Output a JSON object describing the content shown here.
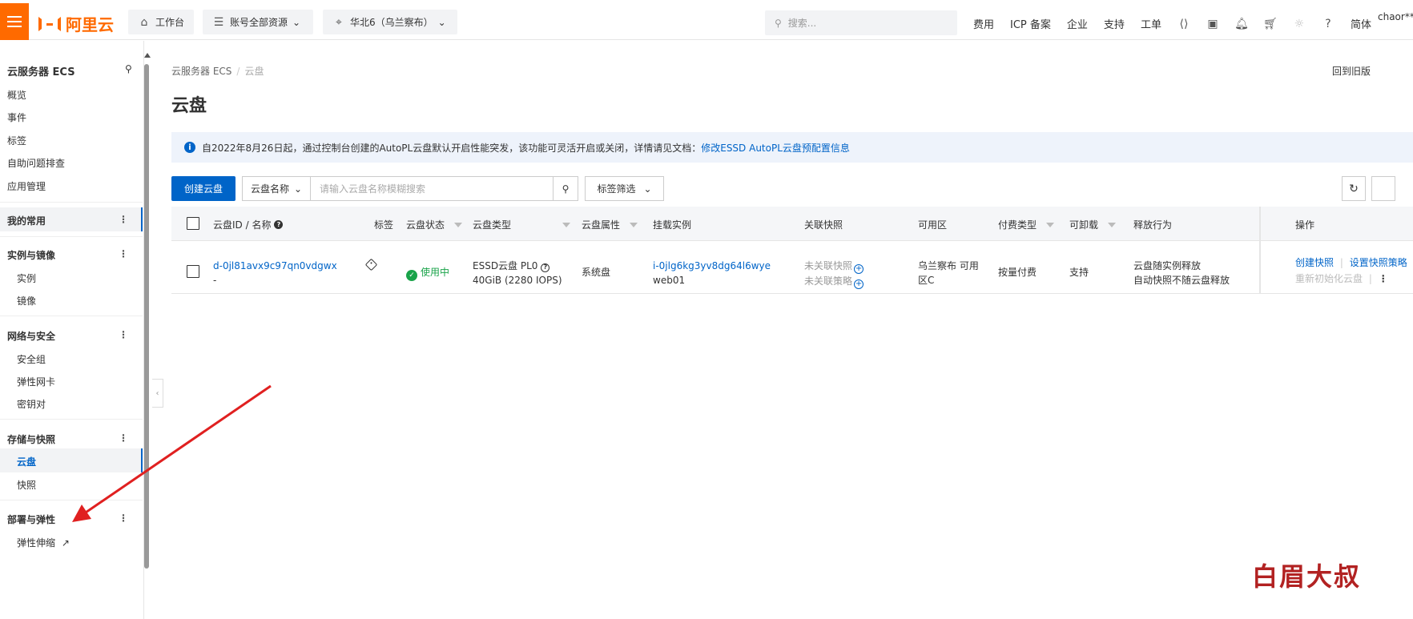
{
  "topbar": {
    "logo_text": "阿里云",
    "workbench": "工作台",
    "account_resources": "账号全部资源",
    "region": "华北6（乌兰察布）",
    "search_placeholder": "搜索...",
    "links": [
      "费用",
      "ICP 备案",
      "企业",
      "支持",
      "工单"
    ],
    "lang": "简体",
    "user": "chaor***"
  },
  "sidebar": {
    "title": "云服务器 ECS",
    "items": [
      "概览",
      "事件",
      "标签",
      "自助问题排查",
      "应用管理"
    ],
    "favorites": "我的常用",
    "groups": [
      {
        "label": "实例与镜像",
        "items": [
          "实例",
          "镜像"
        ]
      },
      {
        "label": "网络与安全",
        "items": [
          "安全组",
          "弹性网卡",
          "密钥对"
        ]
      },
      {
        "label": "存储与快照",
        "items": [
          "云盘",
          "快照"
        ]
      },
      {
        "label": "部署与弹性",
        "items": [
          "弹性伸缩"
        ]
      }
    ]
  },
  "breadcrumb": {
    "parent": "云服务器 ECS",
    "current": "云盘"
  },
  "back_old": "回到旧版",
  "page_title": "云盘",
  "notice": {
    "text": "自2022年8月26日起，通过控制台创建的AutoPL云盘默认开启性能突发，该功能可灵活开启或关闭，详情请见文档：",
    "link": "修改ESSD AutoPL云盘预配置信息"
  },
  "toolbar": {
    "create_label": "创建云盘",
    "filter_field": "云盘名称",
    "filter_placeholder": "请输入云盘名称模糊搜索",
    "tag_filter": "标签筛选"
  },
  "table": {
    "headers": [
      "云盘ID / 名称",
      "标签",
      "云盘状态",
      "云盘类型",
      "云盘属性",
      "挂载实例",
      "关联快照",
      "可用区",
      "付费类型",
      "可卸载",
      "释放行为",
      "操作"
    ],
    "rows": [
      {
        "disk_id": "d-0jl81avx9c97qn0vdgwx",
        "disk_name": "-",
        "status": "使用中",
        "type_line1": "ESSD云盘 PL0",
        "type_line2": "40GiB (2280 IOPS)",
        "attribute": "系统盘",
        "instance_id": "i-0jlg6kg3yv8dg64l6wye",
        "instance_name": "web01",
        "snapshot_line1": "未关联快照",
        "snapshot_line2": "未关联策略",
        "zone_line1": "乌兰察布 可用",
        "zone_line2": "区C",
        "billing": "按量付费",
        "detachable": "支持",
        "release_line1": "云盘随实例释放",
        "release_line2": "自动快照不随云盘释放",
        "action_create_snapshot": "创建快照",
        "action_set_policy": "设置快照策略",
        "action_reinit": "重新初始化云盘"
      }
    ]
  },
  "watermark": "白眉大叔",
  "colors": {
    "brand": "#ff6a00",
    "link": "#0064c8",
    "success": "#1aa34a",
    "arrow": "#e02020"
  }
}
